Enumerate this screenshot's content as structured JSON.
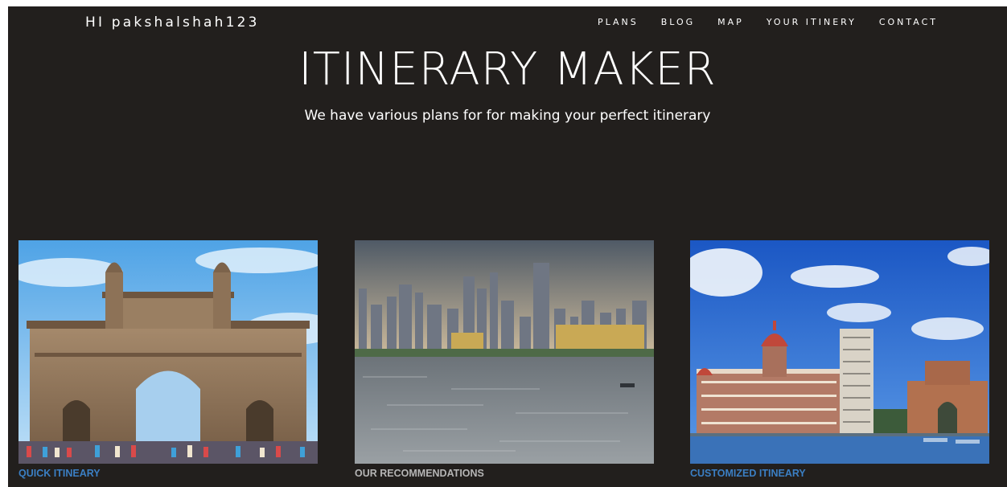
{
  "header": {
    "greeting": "HI pakshalshah123",
    "nav": [
      "PLANS",
      "BLOG",
      "MAP",
      "YOUR ITINERY",
      "CONTACT"
    ]
  },
  "hero": {
    "title": "ITINERARY MAKER",
    "subtitle": "We have various plans for for making your perfect itinerary"
  },
  "cards": [
    {
      "label": "QUICK ITINEARY",
      "label_color": "#3b7fc4"
    },
    {
      "label": "OUR RECOMMENDATIONS",
      "label_color": "#b5b5b5"
    },
    {
      "label": "CUSTOMIZED ITINEARY",
      "label_color": "#3b7fc4"
    }
  ],
  "colors": {
    "background": "#221f1d",
    "text": "#ffffff",
    "link_blue": "#3b7fc4"
  }
}
